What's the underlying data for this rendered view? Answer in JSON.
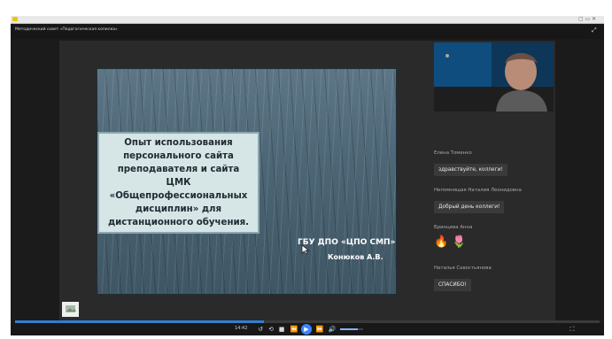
{
  "window": {
    "title": "Методический совет «Педагогическая копилка»"
  },
  "slide": {
    "box_text": "Опыт использования персонального сайта преподавателя и сайта ЦМК «Общепрофессиональных дисциплин» для дистанционного обучения.",
    "org": "ГБУ ДПО «ЦПО СМП»",
    "author": "Конюков А.В."
  },
  "chat": [
    {
      "name": "Елена Томенко",
      "message": "здравствуйте, коллеги!"
    },
    {
      "name": "Непомнящая Наталия Леонидовна",
      "message": "Добрый день коллеги!"
    },
    {
      "name": "Бринцева Анна",
      "emoji": "🔥 🌷"
    },
    {
      "name": "Наталья Савостьянова",
      "message": "СПАСИБО!"
    }
  ],
  "player": {
    "time": "14:42",
    "progress_fraction": 0.425,
    "volume_fraction": 0.75
  },
  "icons": {
    "cursor": "cursor-arrow-icon",
    "play": "play-icon",
    "rewind": "rewind-icon",
    "forward": "fast-forward-icon",
    "skip_back": "skip-back-icon",
    "skip_forward": "skip-forward-icon",
    "volume": "volume-icon",
    "fullscreen": "fullscreen-icon",
    "settings": "settings-icon"
  },
  "colors": {
    "accent": "#3a86ff",
    "slide_box": "#d6e5e6"
  }
}
